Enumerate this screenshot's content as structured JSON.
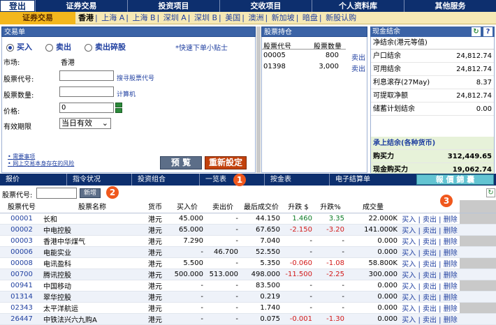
{
  "topnav": {
    "login": "登出",
    "items": [
      "证券交易",
      "投资项目",
      "交收项目",
      "个人资料库",
      "其他服务"
    ]
  },
  "subnav": {
    "section": "证券交易",
    "markets": [
      "香港",
      "上海 A",
      "上海 B",
      "深圳 A",
      "深圳 B",
      "美国",
      "澳洲",
      "新加坡",
      "暗盘",
      "新股认购"
    ],
    "active_market": "香港"
  },
  "order": {
    "title": "交易单",
    "buy": "买入",
    "sell": "卖出",
    "sell_odd": "卖出碎股",
    "tip": "*快速下单小贴士",
    "market_label": "市场:",
    "market_value": "香港",
    "code_label": "股票代号:",
    "search_link": "搜寻股票代号",
    "qty_label": "股票数量:",
    "calc_link": "计算机",
    "price_label": "价格:",
    "price_value": "0",
    "validity_label": "有效期限",
    "validity_value": "当日有效",
    "note1": "需要事项",
    "note2": "网上交易本身存在的风险",
    "preview_btn": "预 覧",
    "reset_btn": "重新設定"
  },
  "holdings": {
    "title": "股票持仓",
    "col_code": "股票代号",
    "col_qty": "股票数量",
    "rows": [
      {
        "code": "00005",
        "qty": "800",
        "action": "卖出"
      },
      {
        "code": "01398",
        "qty": "3,000",
        "action": "卖出"
      }
    ]
  },
  "cash": {
    "title": "现金结余",
    "subtitle": "净结余(港元等值)",
    "rows": [
      {
        "label": "户口结余",
        "value": "24,812.74"
      },
      {
        "label": "可用结余",
        "value": "24,812.74"
      },
      {
        "label": "利息滚存(27May)",
        "value": "8.37"
      },
      {
        "label": "可提取净额",
        "value": "24,812.74"
      },
      {
        "label": "储蓄计划结余",
        "value": "0.00"
      }
    ],
    "settle_title": "承上结余(各种货币)",
    "buying_power_label": "购买力",
    "buying_power_value": "312,449.65",
    "cash_buying_label": "现金购买力",
    "cash_buying_value": "19,062.74"
  },
  "tabs": [
    "报价",
    "指令状况",
    "投资组合",
    "一览表",
    "按金表",
    "电子结算单"
  ],
  "quote_btn": "報 價 錦 囊",
  "quote_row": {
    "label": "股票代号:",
    "add_btn": "新增"
  },
  "badges": [
    "1",
    "2",
    "3"
  ],
  "table": {
    "headers": [
      "股票代号",
      "股票名称",
      "货币",
      "买入价",
      "卖出价",
      "最后成交价",
      "升跌 $",
      "升跌%",
      "成交量",
      ""
    ],
    "rows": [
      {
        "code": "00001",
        "name": "长和",
        "cur": "港元",
        "bid": "45.000",
        "ask": "-",
        "last": "44.150",
        "chg": "1.460",
        "pct": "3.35",
        "vol": "22.000K",
        "dir": "up"
      },
      {
        "code": "00002",
        "name": "中电控股",
        "cur": "港元",
        "bid": "65.000",
        "ask": "-",
        "last": "67.650",
        "chg": "-2.150",
        "pct": "-3.20",
        "vol": "141.000K",
        "dir": "dn"
      },
      {
        "code": "00003",
        "name": "香港中华煤气",
        "cur": "港元",
        "bid": "7.290",
        "ask": "-",
        "last": "7.040",
        "chg": "-",
        "pct": "-",
        "vol": "0.000",
        "dir": ""
      },
      {
        "code": "00006",
        "name": "电能实业",
        "cur": "港元",
        "bid": "-",
        "ask": "46.700",
        "last": "52.550",
        "chg": "-",
        "pct": "-",
        "vol": "0.000",
        "dir": ""
      },
      {
        "code": "00008",
        "name": "电讯盈科",
        "cur": "港元",
        "bid": "5.500",
        "ask": "-",
        "last": "5.350",
        "chg": "-0.060",
        "pct": "-1.08",
        "vol": "58.800K",
        "dir": "dn"
      },
      {
        "code": "00700",
        "name": "腾讯控股",
        "cur": "港元",
        "bid": "500.000",
        "ask": "513.000",
        "last": "498.000",
        "chg": "-11.500",
        "pct": "-2.25",
        "vol": "300.000",
        "dir": "dn"
      },
      {
        "code": "00941",
        "name": "中国移动",
        "cur": "港元",
        "bid": "-",
        "ask": "-",
        "last": "83.500",
        "chg": "-",
        "pct": "-",
        "vol": "0.000",
        "dir": ""
      },
      {
        "code": "01314",
        "name": "翠华控股",
        "cur": "港元",
        "bid": "-",
        "ask": "-",
        "last": "0.219",
        "chg": "-",
        "pct": "-",
        "vol": "0.000",
        "dir": ""
      },
      {
        "code": "02343",
        "name": "太平洋航运",
        "cur": "港元",
        "bid": "-",
        "ask": "-",
        "last": "1.740",
        "chg": "-",
        "pct": "-",
        "vol": "0.000",
        "dir": ""
      },
      {
        "code": "26447",
        "name": "中铁法兴六九购A",
        "cur": "港元",
        "bid": "-",
        "ask": "-",
        "last": "0.075",
        "chg": "-0.001",
        "pct": "-1.30",
        "vol": "0.000",
        "dir": "dn"
      }
    ],
    "actions": {
      "buy": "买入",
      "sell": "卖出",
      "delete": "删除"
    }
  }
}
